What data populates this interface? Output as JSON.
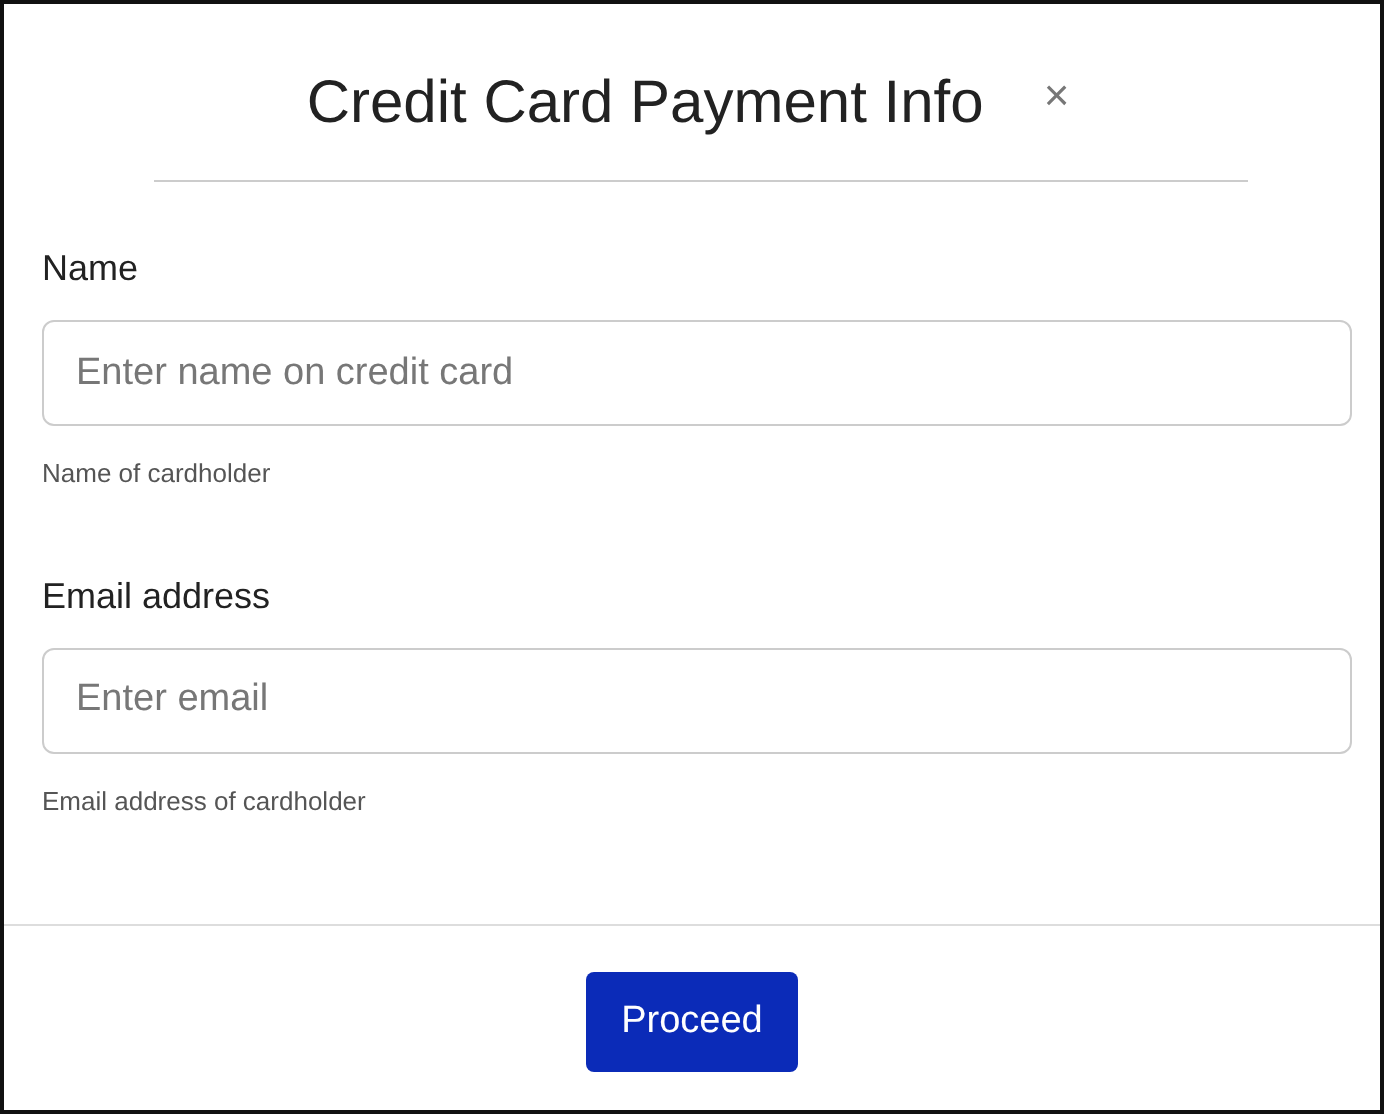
{
  "modal": {
    "title": "Credit Card Payment Info",
    "close": "×"
  },
  "fields": [
    {
      "label": "Name",
      "placeholder": "Enter name on credit card",
      "help": "Name of cardholder"
    },
    {
      "label": "Email address",
      "placeholder": "Enter email",
      "help": "Email address of cardholder"
    }
  ],
  "buttons": [
    "Proceed"
  ]
}
